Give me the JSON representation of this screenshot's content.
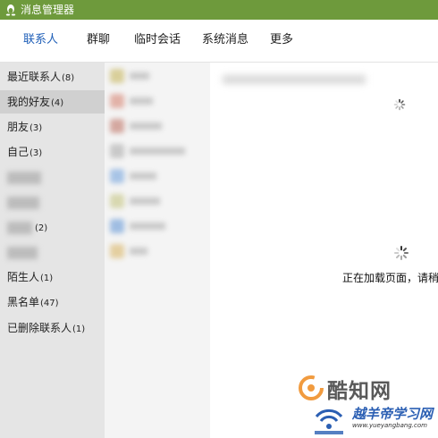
{
  "window": {
    "title": "消息管理器"
  },
  "tabs": [
    {
      "label": "联系人",
      "active": true
    },
    {
      "label": "群聊",
      "active": false
    },
    {
      "label": "临时会话",
      "active": false
    },
    {
      "label": "系统消息",
      "active": false
    },
    {
      "label": "更多",
      "active": false
    }
  ],
  "sidebar": {
    "items": [
      {
        "label": "最近联系人",
        "count": "(8)"
      },
      {
        "label": "我的好友",
        "count": "(4)"
      },
      {
        "label": "朋友",
        "count": "(3)"
      },
      {
        "label": "自己",
        "count": "(3)"
      },
      {
        "label": "",
        "count": ""
      },
      {
        "label": "",
        "count": ""
      },
      {
        "label": "",
        "count": "(2)"
      },
      {
        "label": "",
        "count": ""
      },
      {
        "label": "陌生人",
        "count": "(1)"
      },
      {
        "label": "黑名单",
        "count": "(47)"
      },
      {
        "label": "已删除联系人",
        "count": "(1)"
      }
    ]
  },
  "content": {
    "loading_text": "正在加载页面，请稍"
  },
  "watermarks": {
    "primary_text": "酷知网",
    "secondary_text": "越羊帝学习网",
    "secondary_url": "www.yueyangbang.com"
  },
  "colors": {
    "titlebar": "#6e9a3c",
    "active_tab": "#1f5fb8",
    "sidebar_bg": "#e5e5e5",
    "sidebar_selected": "#d0d0d0",
    "list_bg": "#f4f4f4",
    "watermark_orange": "#f0902a",
    "watermark_blue": "#2b5fb3"
  }
}
